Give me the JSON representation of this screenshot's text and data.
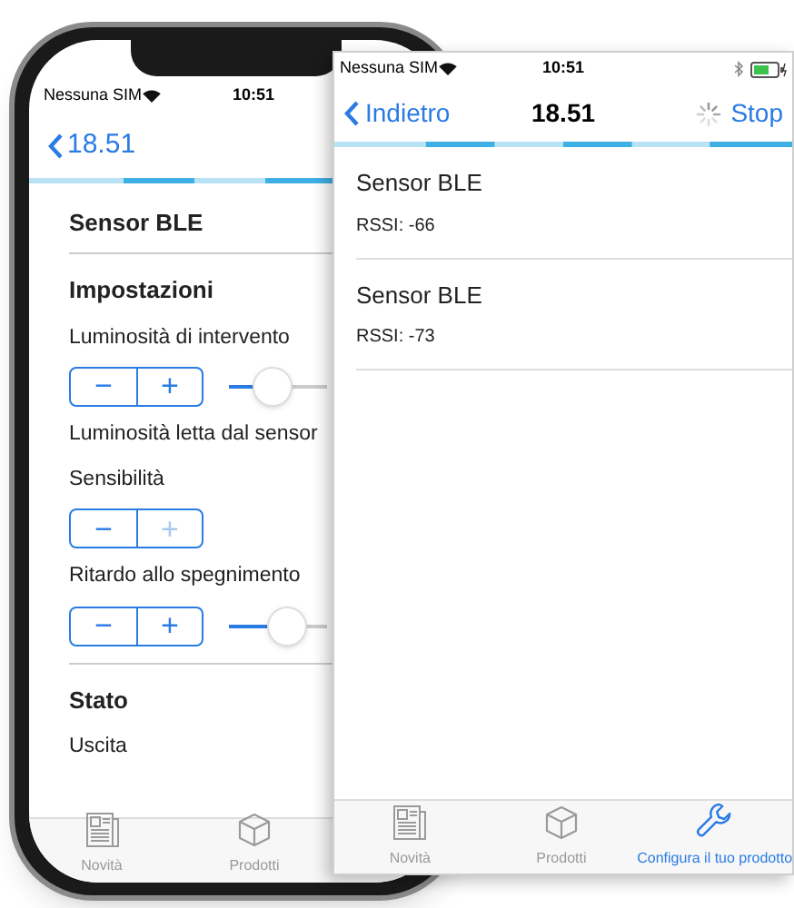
{
  "back_screen": {
    "status_bar": {
      "carrier": "Nessuna SIM",
      "time": "10:51"
    },
    "nav": {
      "back": "18.51"
    },
    "items": [
      {
        "kind": "title",
        "text": "Sensor BLE"
      },
      {
        "kind": "divider"
      },
      {
        "kind": "section",
        "text": "Impostazioni"
      },
      {
        "kind": "label",
        "text": "Luminosità di intervento"
      },
      {
        "kind": "stepper",
        "minus": {
          "label": "−",
          "disabled": false
        },
        "plus": {
          "label": "+",
          "disabled": false
        },
        "slider": {
          "level": 0.45
        }
      },
      {
        "kind": "label",
        "text": "Luminosità letta dal sensor"
      },
      {
        "kind": "label",
        "text": "Sensibilità"
      },
      {
        "kind": "stepper",
        "minus": {
          "label": "−",
          "disabled": false
        },
        "plus": {
          "label": "+",
          "disabled": true
        }
      },
      {
        "kind": "label",
        "text": "Ritardo allo spegnimento"
      },
      {
        "kind": "stepper",
        "minus": {
          "label": "−",
          "disabled": false
        },
        "plus": {
          "label": "+",
          "disabled": false
        },
        "slider": {
          "level": 0.6
        }
      },
      {
        "kind": "divider"
      },
      {
        "kind": "section",
        "text": "Stato"
      },
      {
        "kind": "label",
        "text": "Uscita"
      }
    ],
    "tabs": [
      {
        "label": "Novità",
        "kind": "news",
        "selected": false
      },
      {
        "label": "Prodotti",
        "kind": "box",
        "selected": false
      }
    ]
  },
  "front_screen": {
    "status_bar": {
      "carrier": "Nessuna SIM",
      "time": "10:51"
    },
    "nav": {
      "back": "Indietro",
      "title": "18.51",
      "action": "Stop"
    },
    "devices": [
      {
        "name": "Sensor BLE",
        "rssi": "RSSI: -66"
      },
      {
        "name": "Sensor BLE",
        "rssi": "RSSI: -73"
      }
    ],
    "tabs": [
      {
        "label": "Novità",
        "kind": "news",
        "selected": false
      },
      {
        "label": "Prodotti",
        "kind": "box",
        "selected": false
      },
      {
        "label": "Configura il tuo prodotto",
        "kind": "wrench",
        "selected": true
      }
    ]
  }
}
